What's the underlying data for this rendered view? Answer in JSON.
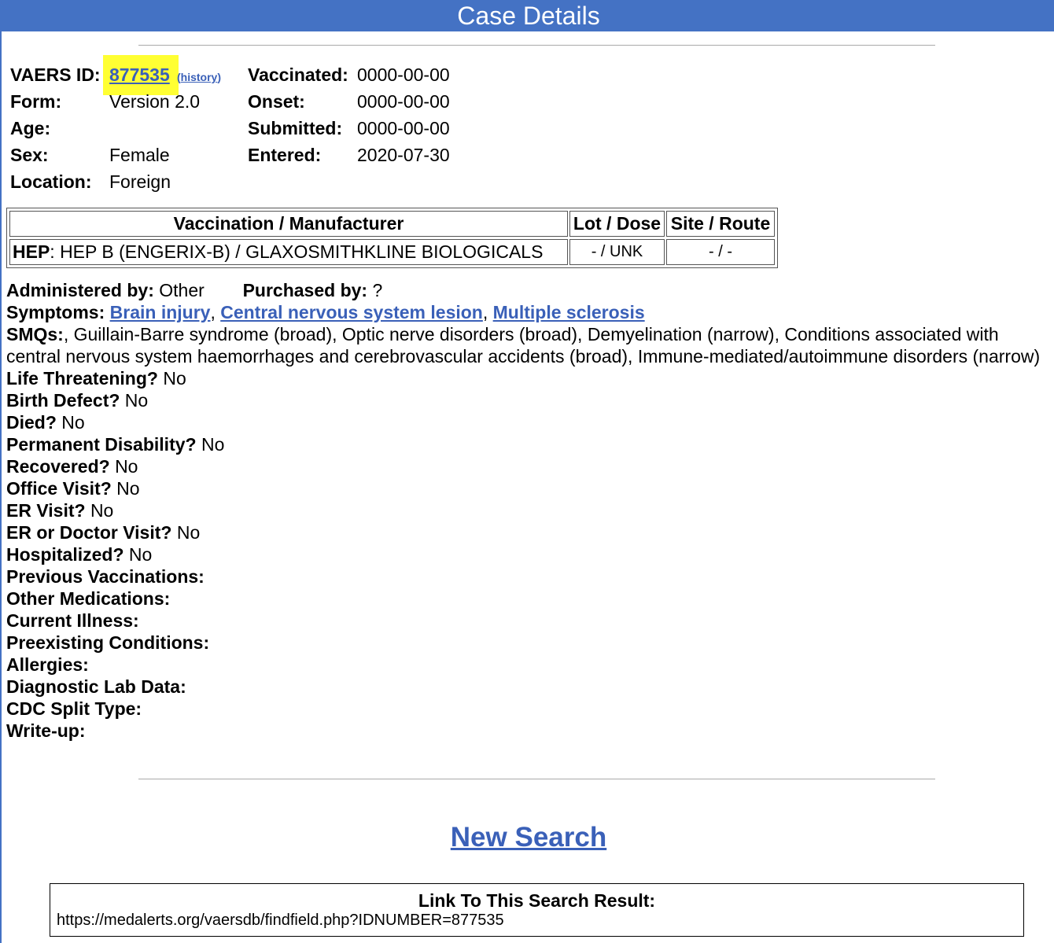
{
  "header": {
    "title": "Case Details"
  },
  "case": {
    "vaers_id_label": "VAERS ID:",
    "vaers_id": "877535",
    "history_open": "(",
    "history_label": "history",
    "history_close": ")",
    "form_label": "Form:",
    "form": "Version 2.0",
    "age_label": "Age:",
    "age": "",
    "sex_label": "Sex:",
    "sex": "Female",
    "location_label": "Location:",
    "location": "Foreign",
    "vaccinated_label": "Vaccinated:",
    "vaccinated": "0000-00-00",
    "onset_label": "Onset:",
    "onset": "0000-00-00",
    "submitted_label": "Submitted:",
    "submitted": "0000-00-00",
    "entered_label": "Entered:",
    "entered": "2020-07-30"
  },
  "vaccination_table": {
    "headers": [
      "Vaccination / Manufacturer",
      "Lot / Dose",
      "Site / Route"
    ],
    "rows": [
      {
        "code": "HEP",
        "rest": ": HEP B (ENGERIX-B) / GLAXOSMITHKLINE BIOLOGICALS",
        "lot_dose": "- / UNK",
        "site_route": "- / -"
      }
    ]
  },
  "details": {
    "administered_label": "Administered by:",
    "administered": "Other",
    "purchased_label": "Purchased by:",
    "purchased": "?",
    "symptoms_label": "Symptoms:",
    "symptoms": [
      "Brain injury",
      "Central nervous system lesion",
      "Multiple sclerosis"
    ],
    "symptom_sep": ",",
    "smqs_label": "SMQs:",
    "smqs": ", Guillain-Barre syndrome (broad), Optic nerve disorders (broad), Demyelination (narrow), Conditions associated with central nervous system haemorrhages and cerebrovascular accidents (broad), Immune-mediated/autoimmune disorders (narrow)",
    "flags": [
      {
        "label": "Life Threatening?",
        "value": "No"
      },
      {
        "label": "Birth Defect?",
        "value": "No"
      },
      {
        "label": "Died?",
        "value": "No"
      },
      {
        "label": "Permanent Disability?",
        "value": "No"
      },
      {
        "label": "Recovered?",
        "value": "No"
      },
      {
        "label": "Office Visit?",
        "value": "No"
      },
      {
        "label": "ER Visit?",
        "value": "No"
      },
      {
        "label": "ER or Doctor Visit?",
        "value": "No"
      },
      {
        "label": "Hospitalized?",
        "value": "No"
      }
    ],
    "empty_fields": [
      "Previous Vaccinations:",
      "Other Medications:",
      "Current Illness:",
      "Preexisting Conditions:",
      "Allergies:",
      "Diagnostic Lab Data:",
      "CDC Split Type:",
      "Write-up:"
    ]
  },
  "footer": {
    "new_search": "New Search",
    "link_title": "Link To This Search Result:",
    "link_url": "https://medalerts.org/vaersdb/findfield.php?IDNUMBER=877535"
  },
  "colors": {
    "header_bg": "#4472c4",
    "link": "#3a60b8",
    "highlight": "#ffff33"
  }
}
